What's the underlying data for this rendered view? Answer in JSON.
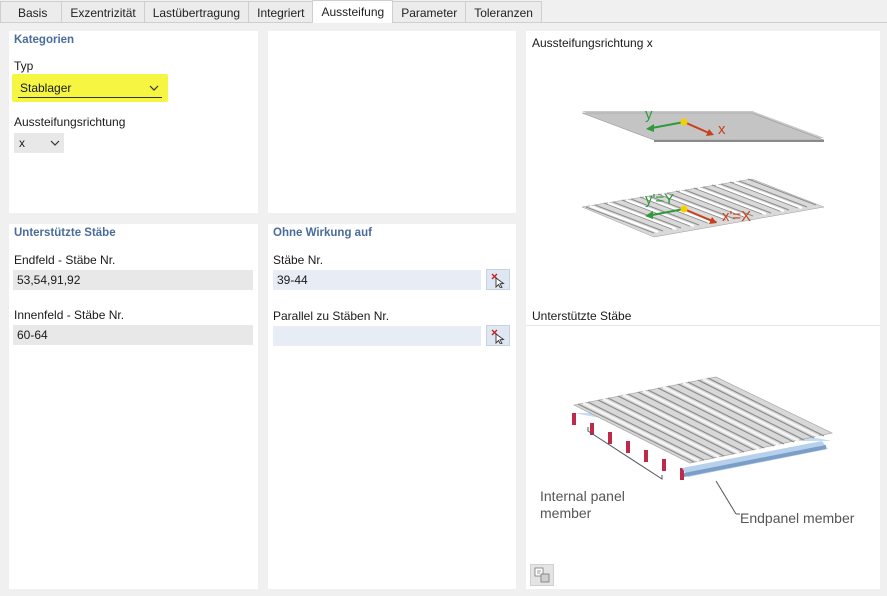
{
  "tabs": [
    {
      "label": "Basis",
      "active": false
    },
    {
      "label": "Exzentrizität",
      "active": false
    },
    {
      "label": "Lastübertragung",
      "active": false
    },
    {
      "label": "Integriert",
      "active": false
    },
    {
      "label": "Aussteifung",
      "active": true
    },
    {
      "label": "Parameter",
      "active": false
    },
    {
      "label": "Toleranzen",
      "active": false
    }
  ],
  "kategorien": {
    "title": "Kategorien",
    "typ_label": "Typ",
    "typ_value": "Stablager",
    "richtung_label": "Aussteifungsrichtung",
    "richtung_value": "x"
  },
  "unterstuetzte": {
    "title": "Unterstützte Stäbe",
    "endfeld_label": "Endfeld - Stäbe Nr.",
    "endfeld_value": "53,54,91,92",
    "innenfeld_label": "Innenfeld - Stäbe Nr.",
    "innenfeld_value": "60-64"
  },
  "ohne_wirkung": {
    "title": "Ohne Wirkung auf",
    "staebe_label": "Stäbe Nr.",
    "staebe_value": "39-44",
    "parallel_label": "Parallel zu Stäben Nr.",
    "parallel_value": ""
  },
  "images": {
    "top_title": "Aussteifungsrichtung x",
    "bottom_title": "Unterstützte Stäbe",
    "axis_y": "y",
    "axis_x": "x",
    "axis_y2": "y'=Y",
    "axis_x2": "x'=X",
    "internal_label_1": "Internal panel",
    "internal_label_2": "member",
    "endpanel_label": "Endpanel member"
  },
  "colors": {
    "section_title": "#4a6c9b",
    "highlight": "#f5f542",
    "axis_green": "#2e9a3a",
    "axis_red": "#c8401c",
    "field_grey": "#e8e8e8",
    "field_blue": "#e7ecf5"
  },
  "icons": {
    "pick": "pick-members-icon",
    "dropdown": "chevron-down-icon",
    "image_options": "image-options-icon"
  }
}
